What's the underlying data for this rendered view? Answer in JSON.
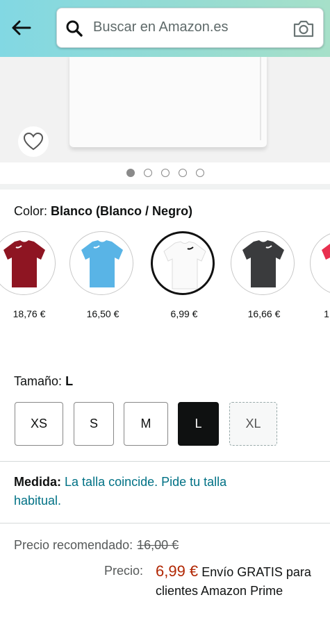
{
  "header": {
    "search_placeholder": "Buscar en Amazon.es"
  },
  "icons": {
    "back": "arrow-left-icon",
    "search": "magnifier-icon",
    "camera": "camera-icon",
    "wishlist": "heart-outline-icon"
  },
  "carousel": {
    "total_dots": 5,
    "active_index": 0
  },
  "color": {
    "label": "Color:",
    "selected": "Blanco (Blanco / Negro)",
    "swatches": [
      {
        "color": "#8e1522",
        "price": "18,76 €",
        "selected": false
      },
      {
        "color": "#59b4e6",
        "price": "16,50 €",
        "selected": false
      },
      {
        "color": "#ffffff",
        "price": "6,99 €",
        "selected": true
      },
      {
        "color": "#3a3b3d",
        "price": "16,66 €",
        "selected": false
      },
      {
        "color": "#e8304f",
        "price": "1",
        "selected": false
      }
    ]
  },
  "size": {
    "label": "Tamaño:",
    "selected": "L",
    "options": [
      "XS",
      "S",
      "M",
      "L",
      "XL"
    ]
  },
  "measure": {
    "label": "Medida:",
    "message": "La talla coincide. Pide tu talla habitual."
  },
  "pricing": {
    "recommended_label": "Precio recomendado:",
    "recommended_value": "16,00 €",
    "price_label": "Precio:",
    "price_value": "6,99 €",
    "shipping": "Envío GRATIS para clientes Amazon Prime"
  },
  "colors": {
    "header_gradient_start": "#82d8e3",
    "header_gradient_end": "#a6e0c9",
    "price_red": "#b12704",
    "link_teal": "#007185"
  }
}
